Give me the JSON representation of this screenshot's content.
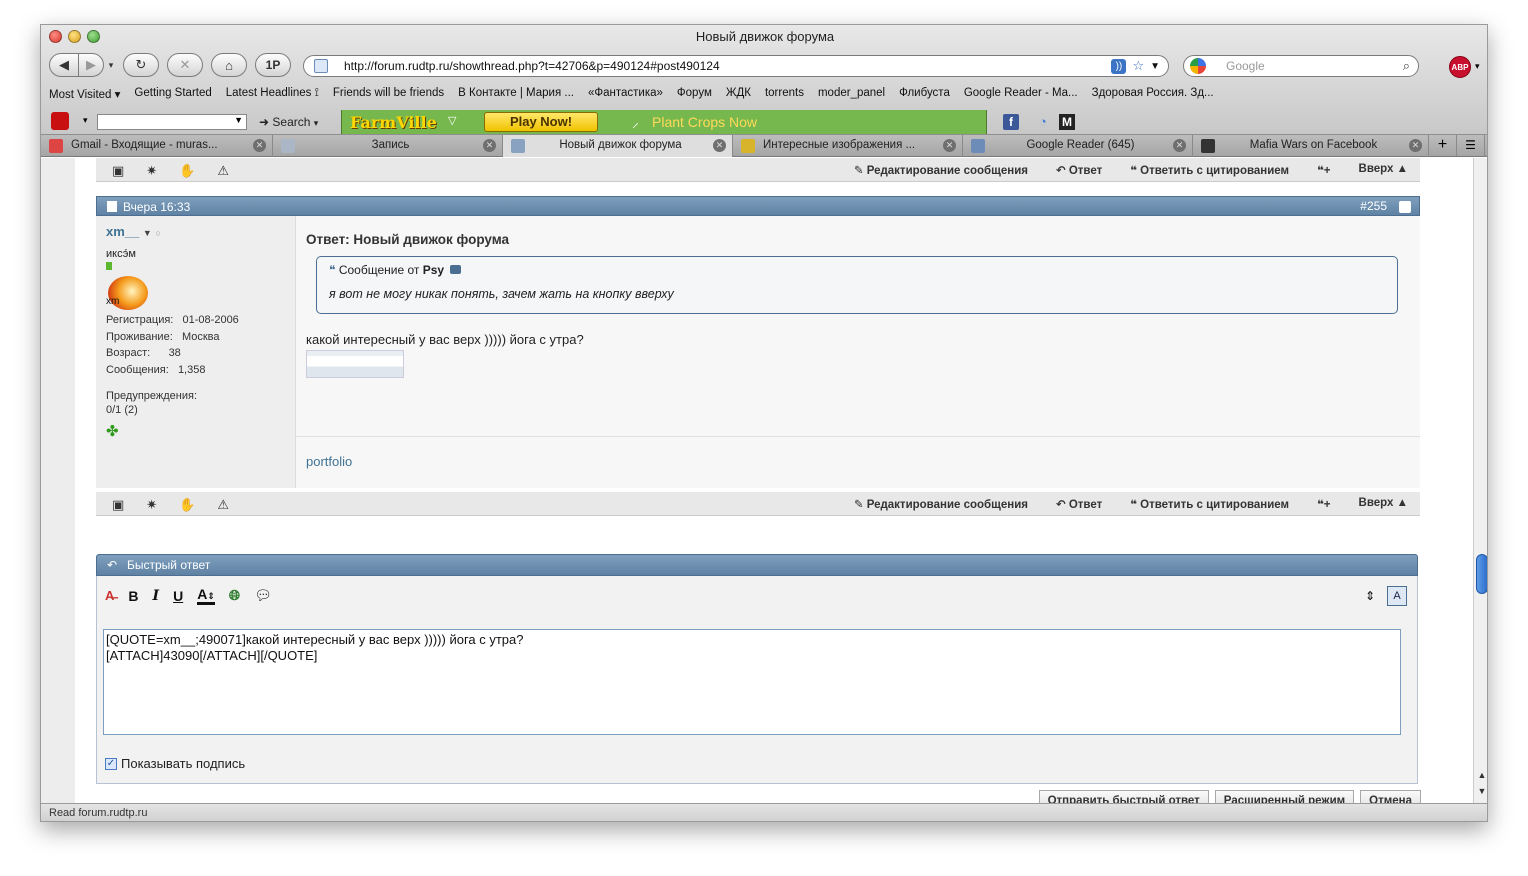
{
  "window": {
    "title": "Новый движок форума"
  },
  "nav": {
    "url": "http://forum.rudtp.ru/showthread.php?t=42706&p=490124#post490124",
    "search_placeholder": "Google",
    "onep_label": "1P",
    "abp_label": "ABP"
  },
  "bookmarks": [
    "Most Visited ▾",
    "Getting Started",
    "Latest Headlines ⟟",
    "Friends will be friends",
    "В Контакте | Мария ...",
    "«Фантастика»",
    "Форум",
    "ЖДК",
    "torrents",
    "moder_panel",
    "Флибуста",
    "Google Reader - Ma...",
    "Здоровая Россия. Зд..."
  ],
  "addons": {
    "search_label": "Search",
    "farmville": "FarmVille",
    "play_now": "Play Now!",
    "plant_crops": "Plant Crops Now",
    "fb": "f",
    "m": "M"
  },
  "tabs": [
    {
      "label": "Gmail - Входящие - muras..."
    },
    {
      "label": "Запись"
    },
    {
      "label": "Новый движок форума"
    },
    {
      "label": "Интересные изображения ..."
    },
    {
      "label": "Google Reader (645)"
    },
    {
      "label": "Mafia Wars on Facebook"
    }
  ],
  "postbar": {
    "edit": "Редактирование сообщения",
    "reply": "Ответ",
    "quote_reply": "Ответить с цитированием",
    "up": "Вверх ▲"
  },
  "post": {
    "date": "Вчера 16:33",
    "number": "#255",
    "title": "Ответ: Новый движок форума",
    "quote_author_prefix": "Сообщение от",
    "quote_author": "Psy",
    "quote_text": "я вот не могу никак понять, зачем жать на кнопку вверху",
    "text": "какой интересный у вас верх ))))) йога с утра?",
    "signature": "portfolio"
  },
  "user": {
    "name": "xm__",
    "title": "иксэ́м",
    "avatar_text": "xm",
    "reg_label": "Регистрация:",
    "reg_value": "01-08-2006",
    "loc_label": "Проживание:",
    "loc_value": "Москва",
    "age_label": "Возраст:",
    "age_value": "38",
    "posts_label": "Сообщения:",
    "posts_value": "1,358",
    "warn_label": "Предупреждения:",
    "warn_value": "0/1 (2)"
  },
  "quick_reply": {
    "title": "Быстрый ответ",
    "text": "[QUOTE=xm__;490071]какой интересный у вас верх ))))) йога с утра?\n[ATTACH]43090[/ATTACH][/QUOTE]",
    "show_signature": "Показывать подпись",
    "send": "Отправить быстрый ответ",
    "advanced": "Расширенный режим",
    "cancel": "Отмена"
  },
  "status": {
    "text": "Read forum.rudtp.ru"
  }
}
